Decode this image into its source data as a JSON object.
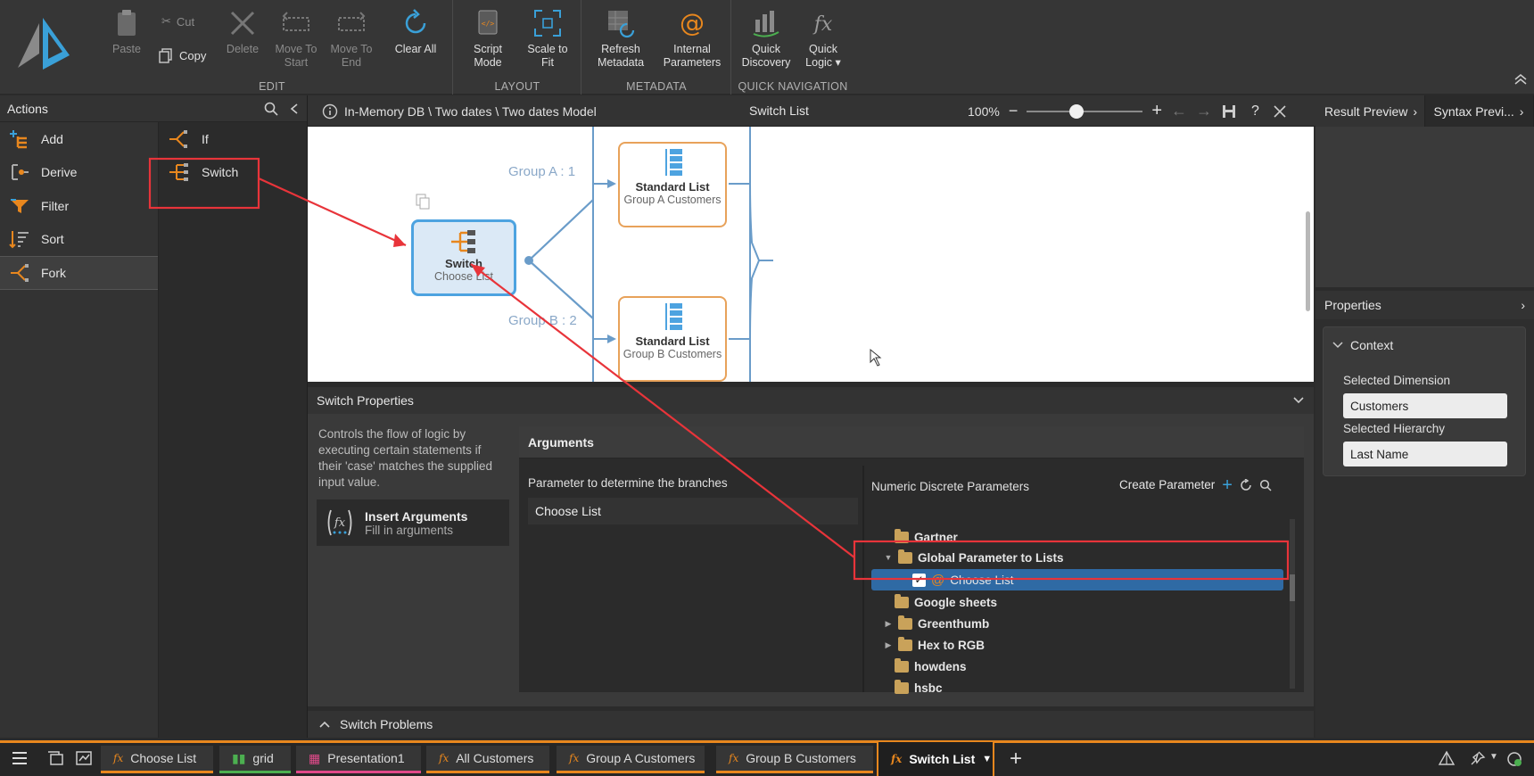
{
  "ribbon": {
    "edit": {
      "label": "EDIT",
      "paste": "Paste",
      "cut": "Cut",
      "copy": "Copy",
      "delete": "Delete",
      "move_to_start": "Move To\nStart",
      "move_to_end": "Move To\nEnd",
      "clear_all": "Clear All"
    },
    "layout": {
      "label": "LAYOUT",
      "script_mode": "Script\nMode",
      "scale_to_fit": "Scale to\nFit"
    },
    "metadata": {
      "label": "METADATA",
      "refresh": "Refresh\nMetadata",
      "internal": "Internal\nParameters"
    },
    "quick_nav": {
      "label": "QUICK NAVIGATION",
      "discovery": "Quick\nDiscovery",
      "logic": "Quick\nLogic ▾"
    }
  },
  "actions": {
    "title": "Actions",
    "items": [
      {
        "label": "Add"
      },
      {
        "label": "Derive"
      },
      {
        "label": "Filter"
      },
      {
        "label": "Sort"
      },
      {
        "label": "Fork"
      }
    ],
    "fork_items": [
      {
        "label": "If"
      },
      {
        "label": "Switch"
      }
    ]
  },
  "header": {
    "breadcrumb": "In-Memory DB \\ Two dates \\ Two dates Model",
    "title": "Switch List",
    "zoom": "100%"
  },
  "canvas": {
    "switch_node": {
      "title": "Switch",
      "sub": "Choose List"
    },
    "group_a": {
      "label": "Group A : 1",
      "title": "Standard List",
      "sub": "Group A Customers"
    },
    "group_b": {
      "label": "Group B : 2",
      "title": "Standard List",
      "sub": "Group B Customers"
    }
  },
  "switch_properties": {
    "title": "Switch Properties",
    "description": "Controls the flow of logic by executing certain statements if their 'case' matches the supplied input value.",
    "insert_title": "Insert Arguments",
    "insert_sub": "Fill in arguments",
    "arguments_title": "Arguments",
    "param_label": "Parameter to determine the branches",
    "param_value": "Choose List",
    "params_header": "Numeric Discrete Parameters",
    "create_param": "Create Parameter",
    "tree": [
      {
        "label": "Gartner"
      },
      {
        "label": "Global Parameter to Lists"
      },
      {
        "label": "Choose List"
      },
      {
        "label": "Google sheets"
      },
      {
        "label": "Greenthumb"
      },
      {
        "label": "Hex to RGB"
      },
      {
        "label": "howdens"
      },
      {
        "label": "hsbc"
      }
    ],
    "problems": "Switch Problems"
  },
  "right": {
    "result_tab": "Result Preview",
    "syntax_tab": "Syntax Previ...",
    "properties": "Properties",
    "context": "Context",
    "dim_label": "Selected Dimension",
    "dim_value": "Customers",
    "hier_label": "Selected Hierarchy",
    "hier_value": "Last Name"
  },
  "tabs": [
    {
      "label": "Choose List",
      "color": "#e8871e"
    },
    {
      "label": "grid",
      "color": "#4caf50"
    },
    {
      "label": "Presentation1",
      "color": "#e04a8a"
    },
    {
      "label": "All Customers",
      "color": "#e8871e"
    },
    {
      "label": "Group A Customers",
      "color": "#e8871e"
    },
    {
      "label": "Group B Customers",
      "color": "#e8871e"
    },
    {
      "label": "Switch List",
      "color": "#e8871e"
    }
  ],
  "colors": {
    "accent": "#e8871e",
    "selection": "#2f6aa4",
    "annotation": "#e8343a",
    "node_blue": "#4da3e0"
  }
}
